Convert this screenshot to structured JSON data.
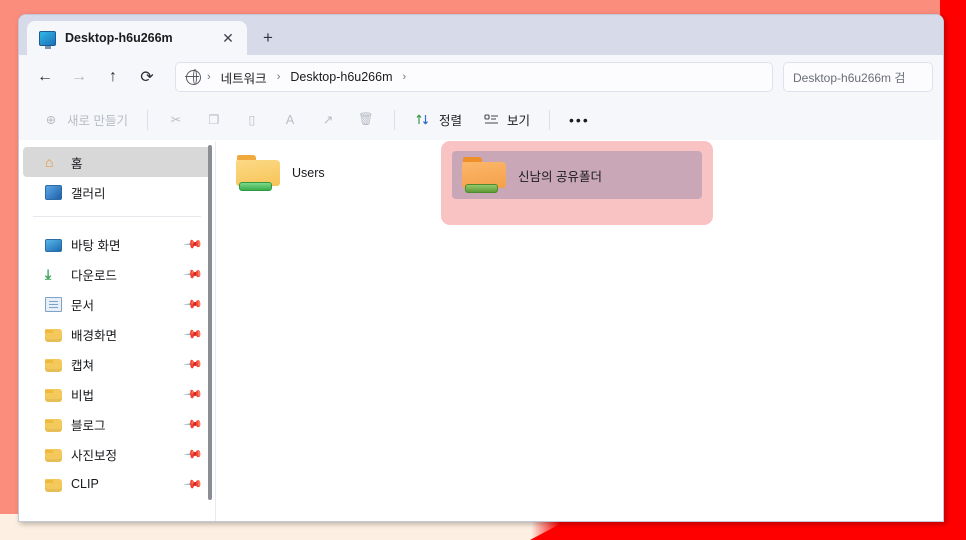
{
  "window": {
    "tab": {
      "title": "Desktop-h6u266m",
      "icon": "monitor-icon",
      "close_label": "✕",
      "new_tab_label": "+"
    }
  },
  "navbar": {
    "back": "←",
    "forward": "→",
    "up": "↑",
    "refresh": "⟳",
    "breadcrumb": {
      "icon": "network-globe-icon",
      "items": [
        "네트워크",
        "Desktop-h6u266m"
      ],
      "separator": "›"
    },
    "search_placeholder": "Desktop-h6u266m 검"
  },
  "toolbar": {
    "new_label": "새로 만들기",
    "new_icon": "plus-circle-icon",
    "cut_icon": "✂",
    "copy_icon": "❐",
    "paste_icon": "📋",
    "rename_icon": "A",
    "share_icon": "↗",
    "delete_icon": "🗑",
    "sort_label": "정렬",
    "sort_icon": "↑↓",
    "view_label": "보기",
    "view_icon": "☰",
    "more_label": "•••"
  },
  "sidebar": {
    "top_items": [
      {
        "label": "홈",
        "icon": "home-icon",
        "selected": true,
        "pinned": false
      },
      {
        "label": "갤러리",
        "icon": "gallery-icon",
        "selected": false,
        "pinned": false
      }
    ],
    "items": [
      {
        "label": "바탕 화면",
        "icon": "desktop-icon",
        "pinned": true
      },
      {
        "label": "다운로드",
        "icon": "download-icon",
        "pinned": true
      },
      {
        "label": "문서",
        "icon": "document-icon",
        "pinned": true
      },
      {
        "label": "배경화면",
        "icon": "folder-icon",
        "pinned": true
      },
      {
        "label": "캡쳐",
        "icon": "folder-icon",
        "pinned": true
      },
      {
        "label": "비법",
        "icon": "folder-icon",
        "pinned": true
      },
      {
        "label": "블로그",
        "icon": "folder-icon",
        "pinned": true
      },
      {
        "label": "사진보정",
        "icon": "folder-icon",
        "pinned": true
      },
      {
        "label": "CLIP",
        "icon": "folder-icon",
        "pinned": true
      }
    ],
    "pin_glyph": "📌"
  },
  "content": {
    "files": [
      {
        "name": "Users",
        "icon": "shared-folder-icon",
        "selected": false
      },
      {
        "name": "신남의 공유폴더",
        "icon": "shared-folder-icon",
        "selected": true
      }
    ]
  },
  "colors": {
    "frame_salmon": "#fb8d7d",
    "frame_red": "#ff0000",
    "highlight_pink": "#f9c3c3",
    "selection_mauve": "#c9a7b6",
    "tabstrip": "#d7dbe9",
    "chrome": "#f6f7fb",
    "sidebar_selected": "#d8d8d8"
  }
}
